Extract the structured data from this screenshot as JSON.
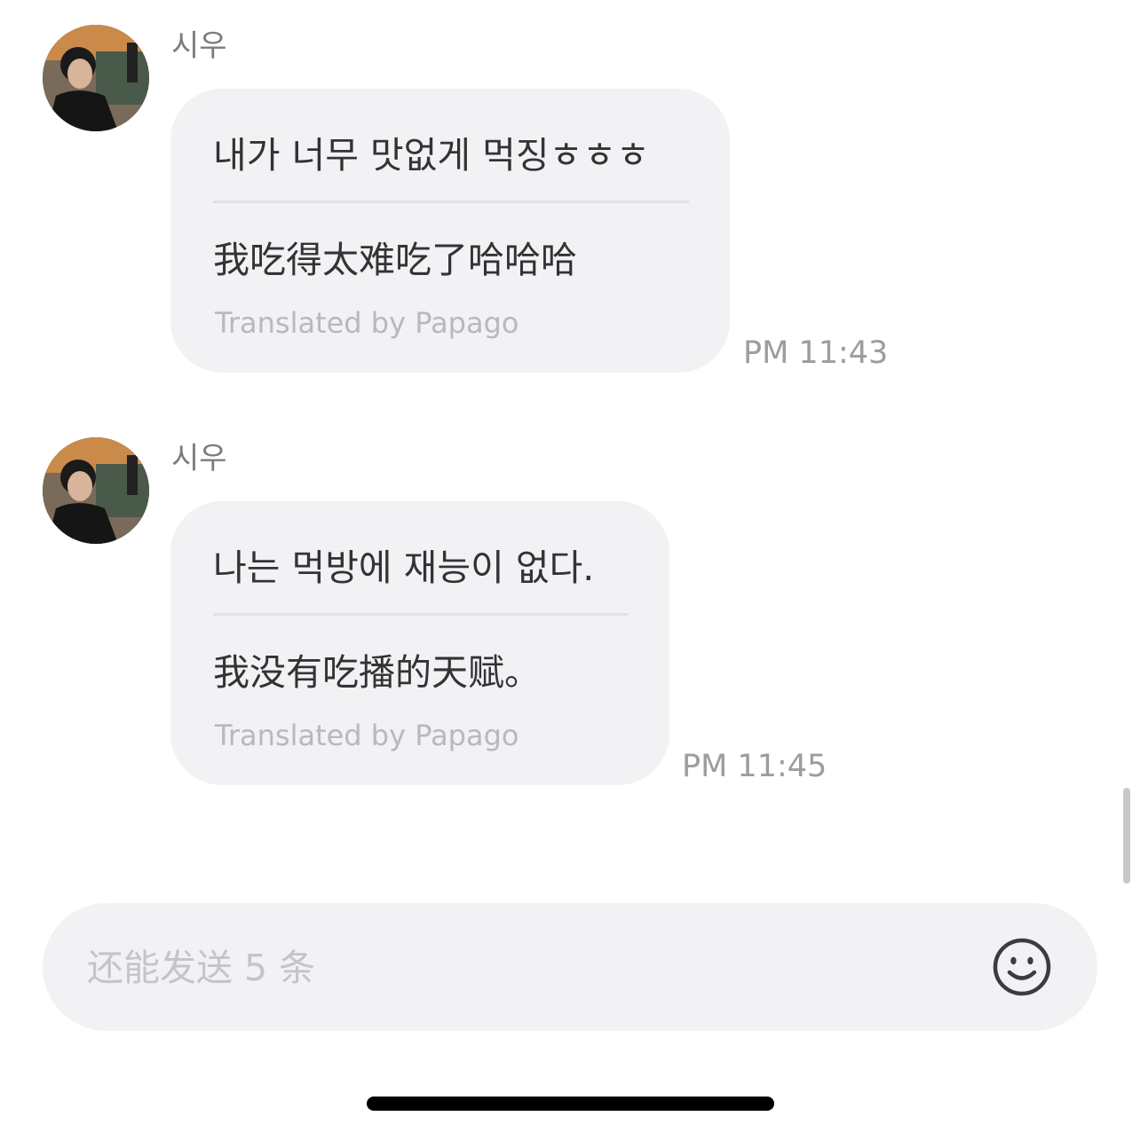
{
  "messages": [
    {
      "sender": "시우",
      "original": "내가 너무 맛없게 먹징ㅎㅎㅎ",
      "translation": "我吃得太难吃了哈哈哈",
      "credit": "Translated by Papago",
      "time": "PM 11:43"
    },
    {
      "sender": "시우",
      "original": "나는 먹방에 재능이 없다.",
      "translation": "我没有吃播的天赋。",
      "credit": "Translated by Papago",
      "time": "PM 11:45"
    }
  ],
  "composer": {
    "placeholder": "还能发送 5 条",
    "emoji_icon": "smiley-icon"
  }
}
